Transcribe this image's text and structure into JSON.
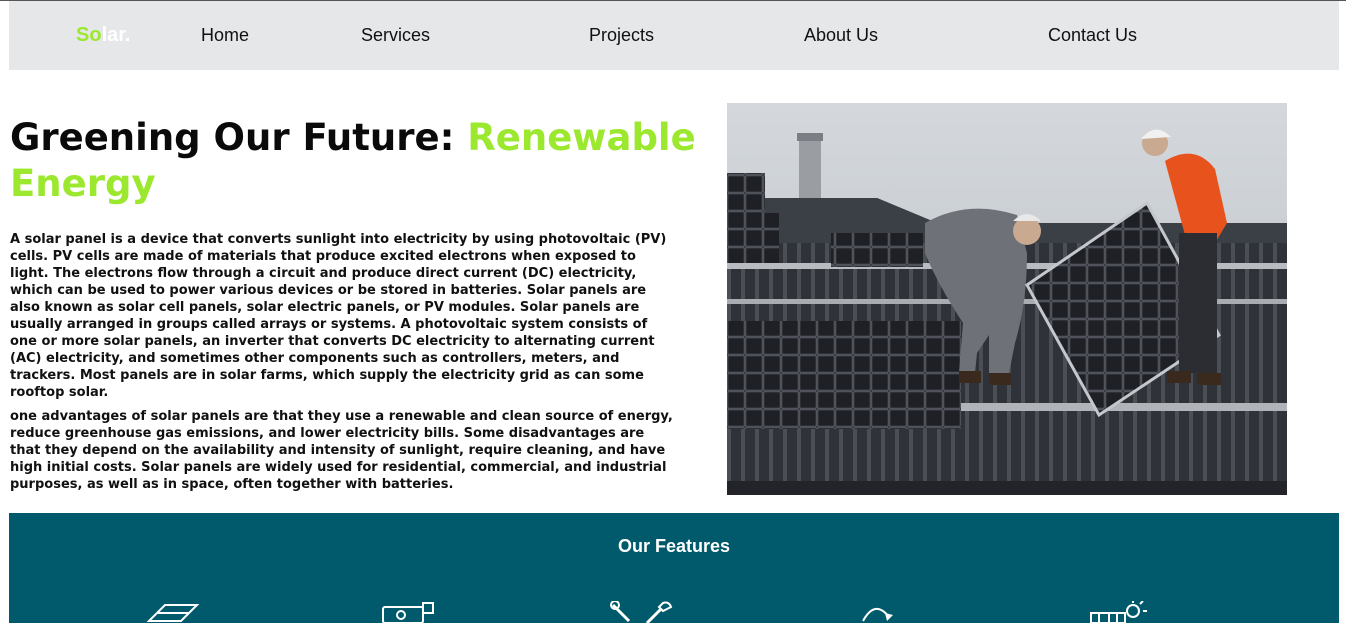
{
  "brand": {
    "logo_part1": "So",
    "logo_part2": "lar."
  },
  "nav": {
    "items": [
      {
        "label": "Home"
      },
      {
        "label": "Services"
      },
      {
        "label": "Projects"
      },
      {
        "label": "About Us"
      },
      {
        "label": "Contact Us"
      }
    ]
  },
  "hero": {
    "title_main": "Greening Our Future: ",
    "title_accent": "Renewable Energy",
    "paragraph1": "A solar panel is a device that converts sunlight into electricity by using photovoltaic (PV) cells. PV cells are made of materials that produce excited electrons when exposed to light. The electrons flow through a circuit and produce direct current (DC) electricity, which can be used to power various devices or be stored in batteries. Solar panels are also known as solar cell panels, solar electric panels, or PV modules. Solar panels are usually arranged in groups called arrays or systems. A photovoltaic system consists of one or more solar panels, an inverter that converts DC electricity to alternating current (AC) electricity, and sometimes other components such as controllers, meters, and trackers. Most panels are in solar farms, which supply the electricity grid as can some rooftop solar.",
    "paragraph2": "one advantages of solar panels are that they use a renewable and clean source of energy, reduce greenhouse gas emissions, and lower electricity bills. Some disadvantages are that they depend on the availability and intensity of sunlight, require cleaning, and have high initial costs. Solar panels are widely used for residential, commercial, and industrial purposes, as well as in space, often together with batteries."
  },
  "features": {
    "title": "Our Features",
    "icons": [
      "solar-panel-icon",
      "battery-charger-icon",
      "tools-icon",
      "sun-cycle-icon",
      "rooftop-solar-icon"
    ]
  },
  "colors": {
    "accent": "#9be82f",
    "nav_bg": "#e6e7e9",
    "features_bg": "#015a6b"
  }
}
